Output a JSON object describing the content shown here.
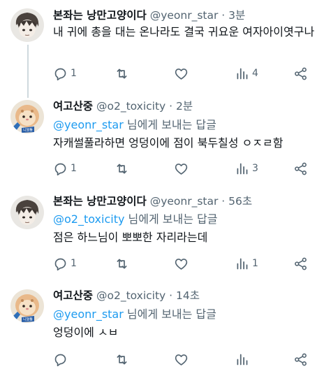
{
  "tweets": [
    {
      "name": "본좌는 낭만고양이다",
      "handle": "@yeonr_star",
      "dot": "·",
      "time": "3분",
      "text": "내 귀에 총을 대는 온나라도 결국 귀요운 여자아이엿구나",
      "replies": "1",
      "retweets": "",
      "likes": "",
      "views": "4"
    },
    {
      "name": "여고산중",
      "handle": "@o2_toxicity",
      "dot": "·",
      "time": "2분",
      "reply_mention": "@yeonr_star",
      "reply_suffix": " 님에게 보내는 답글",
      "text": "자캐썰풀라하면 엉덩이에 점이 북두칠성 ㅇㅈㄹ함",
      "replies": "1",
      "retweets": "",
      "likes": "",
      "views": "3"
    },
    {
      "name": "본좌는 낭만고양이다",
      "handle": "@yeonr_star",
      "dot": "·",
      "time": "56초",
      "reply_mention": "@o2_toxicity",
      "reply_suffix": " 님에게 보내는 답글",
      "text": "점은 하느님이 뽀뽀한 자리라는데",
      "replies": "1",
      "retweets": "",
      "likes": "",
      "views": "1"
    },
    {
      "name": "여고산중",
      "handle": "@o2_toxicity",
      "dot": "·",
      "time": "14초",
      "reply_mention": "@yeonr_star",
      "reply_suffix": " 님에게 보내는 답글",
      "text": "엉덩이에 ㅅㅂ",
      "replies": "",
      "retweets": "",
      "likes": "",
      "views": ""
    }
  ],
  "colors": {
    "text": "#0f1419",
    "secondary": "#536471",
    "mention": "#1d9bf0",
    "thread_line": "#cfd9de"
  },
  "icons": [
    "reply-icon",
    "retweet-icon",
    "like-icon",
    "views-icon",
    "share-icon"
  ]
}
